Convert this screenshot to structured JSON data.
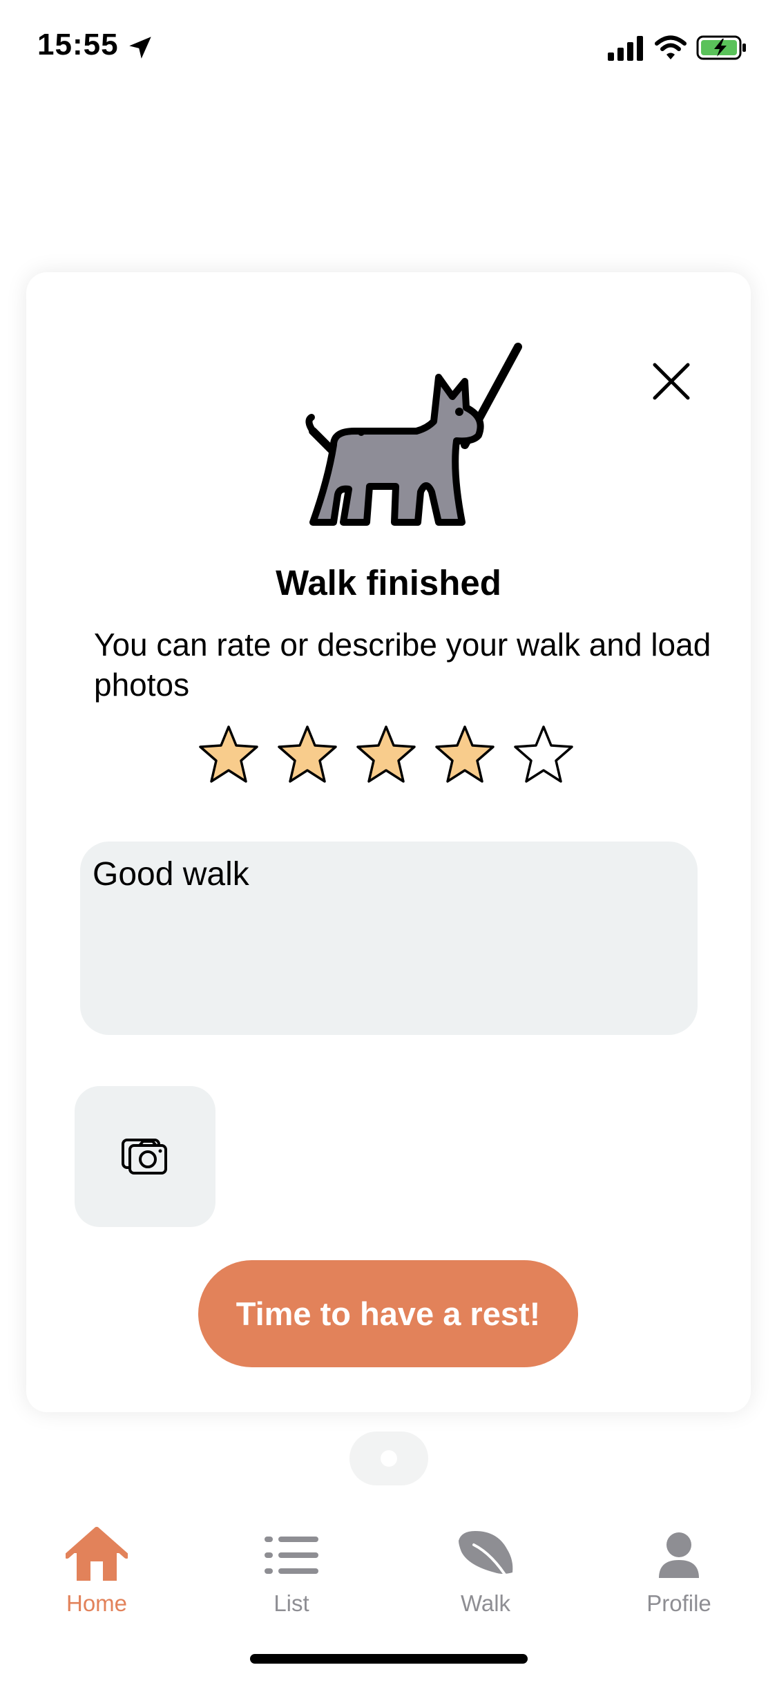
{
  "status_bar": {
    "time": "15:55"
  },
  "modal": {
    "title": "Walk finished",
    "subtitle": "You can rate or describe your walk and load photos",
    "rating": {
      "value": 4,
      "max": 5
    },
    "notes_value": "Good walk",
    "primary_button": "Time to have a rest!"
  },
  "tabs": [
    {
      "label": "Home",
      "icon": "home-icon",
      "active": true
    },
    {
      "label": "List",
      "icon": "list-icon",
      "active": false
    },
    {
      "label": "Walk",
      "icon": "leaf-icon",
      "active": false
    },
    {
      "label": "Profile",
      "icon": "profile-icon",
      "active": false
    }
  ],
  "colors": {
    "accent": "#e2825a",
    "star_fill": "#f8cc8c",
    "input_bg": "#eef1f2",
    "dog_fill": "#8e8d97",
    "inactive_tab": "#8e8e93"
  }
}
